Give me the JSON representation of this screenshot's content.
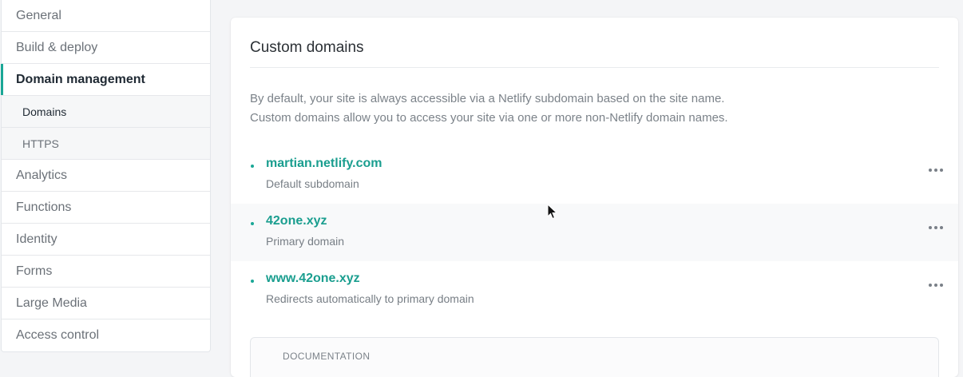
{
  "sidebar": {
    "items": [
      {
        "label": "General"
      },
      {
        "label": "Build & deploy"
      },
      {
        "label": "Domain management",
        "active": true
      },
      {
        "label": "Domains",
        "sub": true,
        "active": true
      },
      {
        "label": "HTTPS",
        "sub": true
      },
      {
        "label": "Analytics"
      },
      {
        "label": "Functions"
      },
      {
        "label": "Identity"
      },
      {
        "label": "Forms"
      },
      {
        "label": "Large Media"
      },
      {
        "label": "Access control"
      }
    ]
  },
  "main": {
    "title": "Custom domains",
    "description": [
      "By default, your site is always accessible via a Netlify subdomain based on the site name.",
      "Custom domains allow you to access your site via one or more non-Netlify domain names."
    ],
    "domains": [
      {
        "name": "martian.netlify.com",
        "note": "Default subdomain"
      },
      {
        "name": "42one.xyz",
        "note": "Primary domain"
      },
      {
        "name": "www.42one.xyz",
        "note": "Redirects automatically to primary domain"
      }
    ],
    "doc_label": "DOCUMENTATION"
  },
  "colors": {
    "accent": "#1aa796",
    "link": "#1a9e8f"
  },
  "icons": {
    "more": "more-horizontal-icon",
    "cursor": "mouse-pointer-icon"
  }
}
